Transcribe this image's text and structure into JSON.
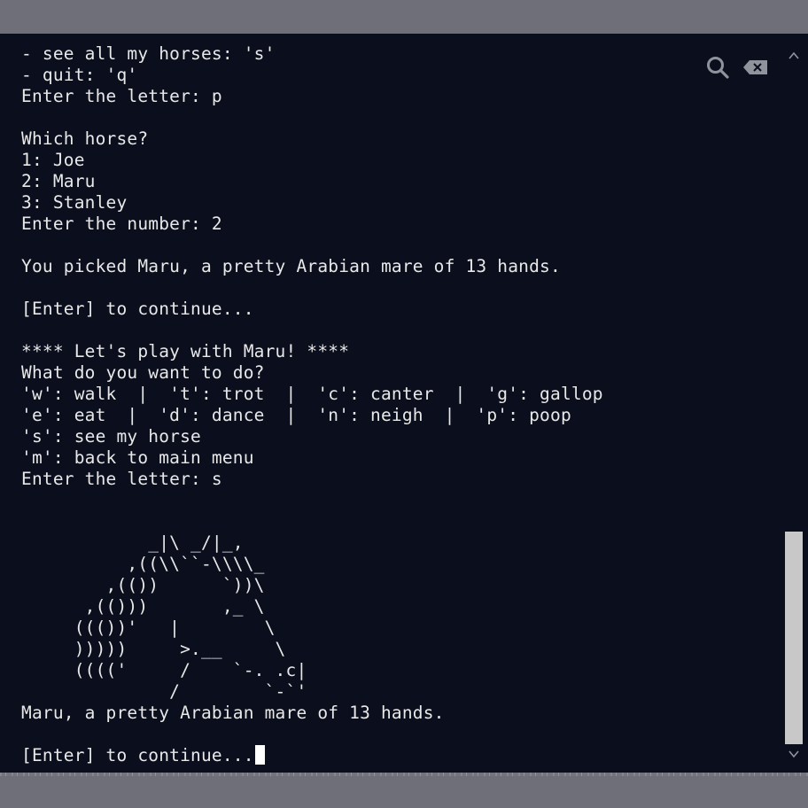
{
  "terminal": {
    "lines": [
      "- see all my horses: 's'",
      "- quit: 'q'",
      "Enter the letter: p",
      "",
      "Which horse?",
      "1: Joe",
      "2: Maru",
      "3: Stanley",
      "Enter the number: 2",
      "",
      "You picked Maru, a pretty Arabian mare of 13 hands.",
      "",
      "[Enter] to continue...",
      "",
      "**** Let's play with Maru! ****",
      "What do you want to do?",
      "'w': walk  |  't': trot  |  'c': canter  |  'g': gallop",
      "'e': eat  |  'd': dance  |  'n': neigh  |  'p': poop",
      "'s': see my horse",
      "'m': back to main menu",
      "Enter the letter: s",
      "",
      "",
      "            _|\\ _/|_,",
      "          ,((\\\\``-\\\\\\\\_",
      "        ,(())      `))\\",
      "      ,(()))       ,_ \\",
      "     ((())'   |        \\",
      "     )))))     >.__     \\",
      "     (((('     /    `-. .c|",
      "              /        `-`'",
      "Maru, a pretty Arabian mare of 13 hands.",
      "",
      "[Enter] to continue..."
    ]
  },
  "icons": {
    "search": "search-icon",
    "clear": "backspace-clear-icon",
    "scroll_up": "chevron-up-icon",
    "scroll_down": "chevron-down-icon"
  },
  "colors": {
    "terminal_bg": "#0b0f1d",
    "text": "#e8e8e8",
    "frame": "#6e6f78",
    "scroll_thumb": "#c8c8c8"
  },
  "scroll": {
    "position_fraction": 1.0
  }
}
